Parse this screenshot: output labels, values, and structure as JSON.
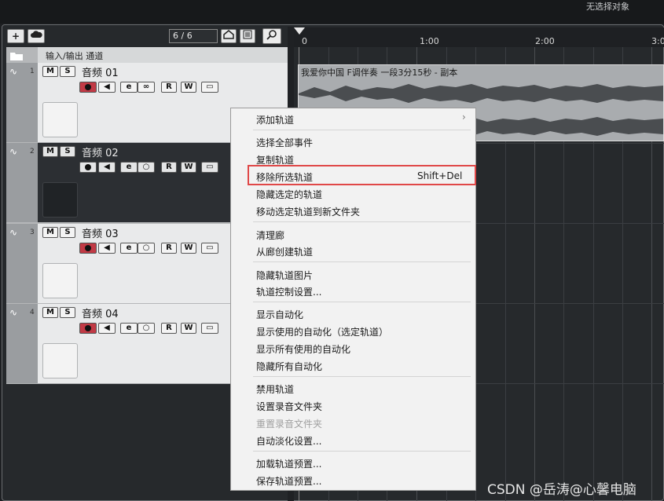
{
  "status_text": "无选择对象",
  "toolbar": {
    "add_label": "+",
    "counter": "6 / 6"
  },
  "track_header": {
    "folder_label": "输入/输出 通道"
  },
  "tracks": [
    {
      "number": "1",
      "name": "音频 01",
      "mute": "M",
      "solo": "S",
      "read": "R",
      "write": "W"
    },
    {
      "number": "2",
      "name": "音频 02",
      "mute": "M",
      "solo": "S",
      "read": "R",
      "write": "W"
    },
    {
      "number": "3",
      "name": "音频 03",
      "mute": "M",
      "solo": "S",
      "read": "R",
      "write": "W"
    },
    {
      "number": "4",
      "name": "音频 04",
      "mute": "M",
      "solo": "S",
      "read": "R",
      "write": "W"
    }
  ],
  "ruler": {
    "ticks": [
      "0",
      "1:00",
      "2:00",
      "3:0"
    ]
  },
  "clip": {
    "name": "我爱你中国 F调伴奏 一段3分15秒 - 副本"
  },
  "context_menu": {
    "items": [
      {
        "label": "添加轨道",
        "arrow": "›"
      },
      {
        "label": "选择全部事件"
      },
      {
        "label": "复制轨道"
      },
      {
        "label": "移除所选轨道",
        "shortcut": "Shift+Del"
      },
      {
        "label": "隐藏选定的轨道"
      },
      {
        "label": "移动选定轨道到新文件夹"
      },
      {
        "label": "清理廊"
      },
      {
        "label": "从廊创建轨道"
      },
      {
        "label": "隐藏轨道图片"
      },
      {
        "label": "轨道控制设置..."
      },
      {
        "label": "显示自动化"
      },
      {
        "label": "显示使用的自动化（选定轨道）"
      },
      {
        "label": "显示所有使用的自动化"
      },
      {
        "label": "隐藏所有自动化"
      },
      {
        "label": "禁用轨道"
      },
      {
        "label": "设置录音文件夹"
      },
      {
        "label": "重置录音文件夹"
      },
      {
        "label": "自动淡化设置..."
      },
      {
        "label": "加载轨道预置..."
      },
      {
        "label": "保存轨道预置..."
      }
    ]
  },
  "watermark": "CSDN @岳涛@心馨电脑",
  "colors": {
    "record": "#c13a45",
    "highlight": "#e04848",
    "selected_track": "#2c2f33"
  }
}
